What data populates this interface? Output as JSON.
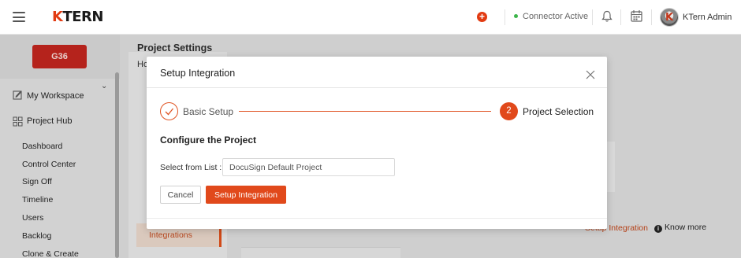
{
  "header": {
    "logo_text": "TERN",
    "logo_k": "K",
    "connector_status": "Connector Active",
    "user_name": "KTern Admin",
    "icons": [
      "menu-icon",
      "add-icon",
      "bell-icon",
      "calendar-icon",
      "avatar"
    ],
    "accent_color": "#e1491b",
    "status_color": "#3cb54a"
  },
  "sidebar": {
    "badge": "G36",
    "items": [
      {
        "label": "My Workspace",
        "icon": "workspace-icon"
      },
      {
        "label": "Project Hub",
        "icon": "grid-icon"
      }
    ],
    "sub_items": [
      "Dashboard",
      "Control Center",
      "Sign Off",
      "Timeline",
      "Users",
      "Backlog",
      "Clone & Create"
    ]
  },
  "page": {
    "title": "Project Settings",
    "breadcrumb_fragment": "Ho",
    "active_settings_item": "Integrations",
    "setup_link": "Setup Integration",
    "know_more": "Know more"
  },
  "modal": {
    "title": "Setup Integration",
    "steps": [
      {
        "number": "",
        "label": "Basic Setup",
        "state": "completed"
      },
      {
        "number": "2",
        "label": "Project Selection",
        "state": "active"
      }
    ],
    "section_title": "Configure the Project",
    "field_label": "Select from List :",
    "field_value": "DocuSign Default Project",
    "cancel_label": "Cancel",
    "submit_label": "Setup Integration"
  }
}
